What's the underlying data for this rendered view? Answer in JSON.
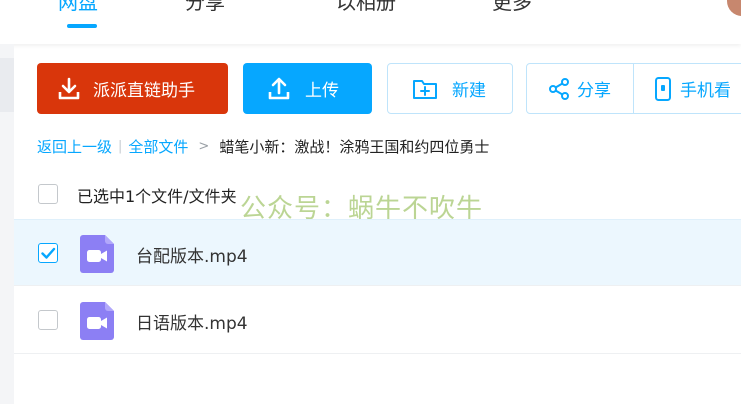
{
  "nav": {
    "tabs": [
      {
        "label": "网盘",
        "active": true
      },
      {
        "label": "分享",
        "active": false
      },
      {
        "label": "以相册",
        "active": false
      },
      {
        "label": "更多",
        "active": false
      }
    ]
  },
  "toolbar": {
    "paipai_label": "派派直链助手",
    "upload_label": "上传",
    "new_label": "新建",
    "share_label": "分享",
    "phone_label": "手机看"
  },
  "breadcrumb": {
    "back_label": "返回上一级",
    "separator": "|",
    "all_files_label": "全部文件",
    "chevron": ">",
    "current_folder": "蜡笔小新：激战！涂鸦王国和约四位勇士"
  },
  "selection": {
    "count_text": "已选中1个文件/文件夹"
  },
  "watermark": "公众号：蜗牛不吹牛",
  "files": [
    {
      "name": "台配版本.mp4",
      "checked": true
    },
    {
      "name": "日语版本.mp4",
      "checked": false
    }
  ],
  "colors": {
    "accent": "#06a7ff",
    "paipai_button": "#d9360b",
    "video_icon": "#8c7ff4",
    "selected_row": "#ecf7fe"
  },
  "icons": {
    "paipai": "download-icon",
    "upload": "upload-icon",
    "new": "folder-add-icon",
    "share": "share-icon",
    "phone": "phone-icon",
    "file": "video-file-icon",
    "check": "checkmark-icon"
  }
}
